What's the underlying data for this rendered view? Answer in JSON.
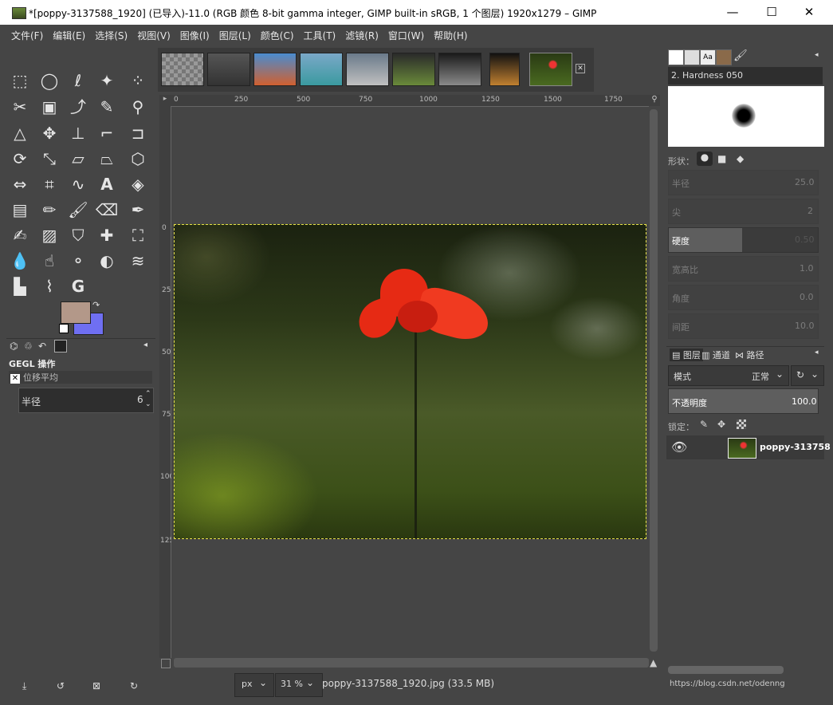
{
  "window": {
    "title": "*[poppy-3137588_1920] (已导入)-11.0 (RGB 颜色 8-bit gamma integer, GIMP built-in sRGB, 1 个图层) 1920x1279 – GIMP",
    "minimize": "—",
    "maximize": "☐",
    "close": "✕"
  },
  "menubar": [
    "文件(F)",
    "编辑(E)",
    "选择(S)",
    "视图(V)",
    "图像(I)",
    "图层(L)",
    "颜色(C)",
    "工具(T)",
    "滤镜(R)",
    "窗口(W)",
    "帮助(H)"
  ],
  "toolbox": {
    "fg_color": "#b39889",
    "bg_color": "#6f6ff2",
    "panel_title": "GEGL 操作",
    "panel_sub": "位移平均",
    "radius_label": "半径",
    "radius_value": "6"
  },
  "ruler": {
    "h": [
      "0",
      "250",
      "500",
      "750",
      "1000",
      "1250",
      "1500",
      "1750"
    ],
    "v": [
      "0",
      "250",
      "500",
      "750",
      "1000",
      "1250"
    ]
  },
  "status": {
    "unit": "px",
    "zoom": "31 %",
    "file_info": "poppy-3137588_1920.jpg (33.5 MB)"
  },
  "dock": {
    "brush_name": "2. Hardness 050",
    "shape_label": "形状：",
    "sliders": [
      {
        "label": "半径",
        "value": "25.0"
      },
      {
        "label": "尖",
        "value": "2"
      },
      {
        "label": "硬度",
        "value": "0.50"
      },
      {
        "label": "宽高比",
        "value": "1.0"
      },
      {
        "label": "角度",
        "value": "0.0"
      },
      {
        "label": "间距",
        "value": "10.0"
      }
    ],
    "tabs": [
      "图层",
      "通道",
      "路径"
    ],
    "mode_label": "模式",
    "mode_value": "正常",
    "opacity_label": "不透明度",
    "opacity_value": "100.0",
    "lock_label": "锁定：",
    "layer_name": "poppy-313758"
  },
  "watermark": "https://blog.csdn.net/odenng"
}
